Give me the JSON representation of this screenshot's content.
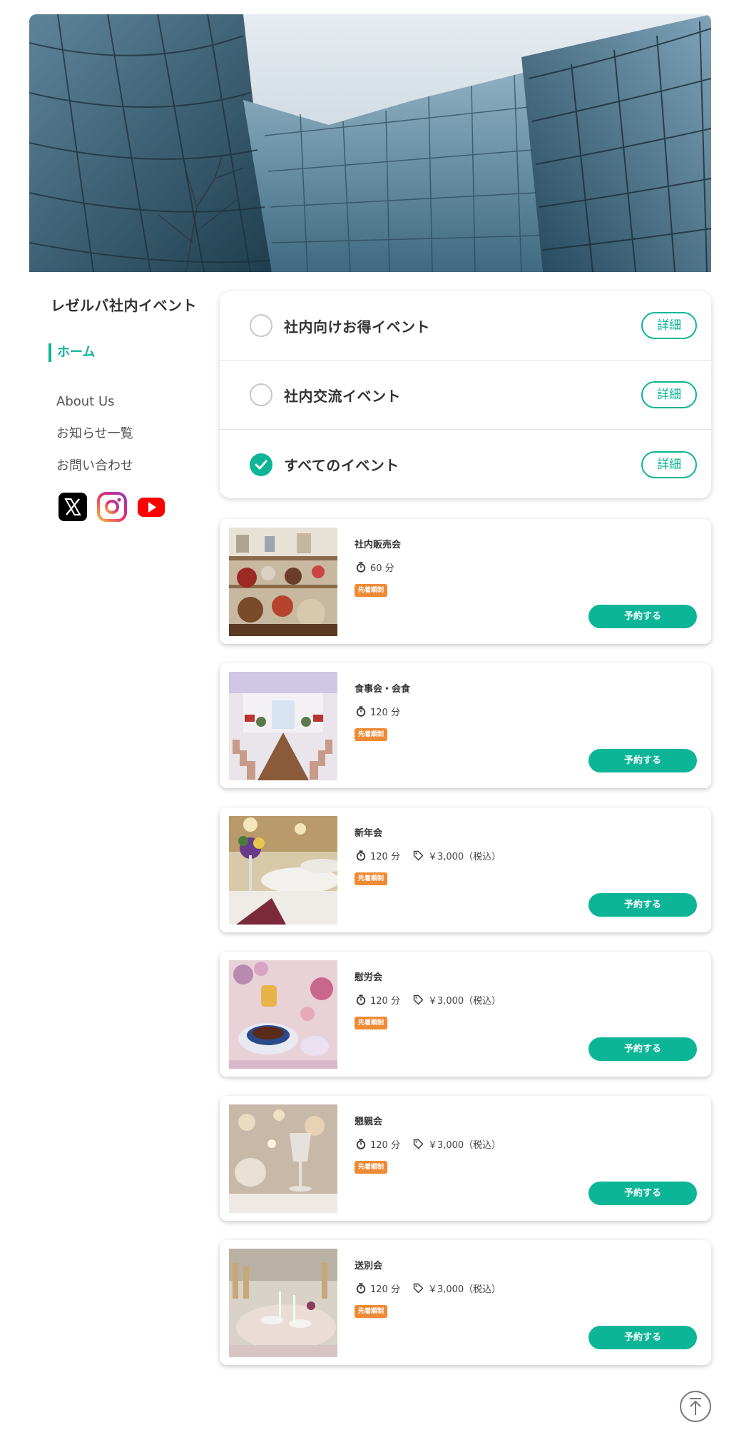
{
  "site": {
    "title": "レゼルバ社内イベント"
  },
  "nav": {
    "active": "ホーム",
    "items": [
      "About Us",
      "お知らせ一覧",
      "お問い合わせ"
    ]
  },
  "socials": [
    {
      "icon": "x-icon",
      "color": "#000000"
    },
    {
      "icon": "instagram-icon",
      "color": "#e1306c"
    },
    {
      "icon": "youtube-icon",
      "color": "#ff0000"
    }
  ],
  "filters": [
    {
      "label": "社内向けお得イベント",
      "checked": false,
      "detail": "詳細"
    },
    {
      "label": "社内交流イベント",
      "checked": false,
      "detail": "詳細"
    },
    {
      "label": "すべてのイベント",
      "checked": true,
      "detail": "詳細"
    }
  ],
  "events": [
    {
      "title": "社内販売会",
      "duration": "60 分",
      "price": "",
      "badge": "先着順制",
      "button": "予約する",
      "image": "market-photo"
    },
    {
      "title": "食事会・会食",
      "duration": "120 分",
      "price": "",
      "badge": "先着順制",
      "button": "予約する",
      "image": "banquet-hall-photo"
    },
    {
      "title": "新年会",
      "duration": "120 分",
      "price": "￥3,000（税込）",
      "badge": "先着順制",
      "button": "予約する",
      "image": "ballroom-photo"
    },
    {
      "title": "慰労会",
      "duration": "120 分",
      "price": "￥3,000（税込）",
      "badge": "先着順制",
      "button": "予約する",
      "image": "tea-table-photo"
    },
    {
      "title": "懇親会",
      "duration": "120 分",
      "price": "￥3,000（税込）",
      "badge": "先着順制",
      "button": "予約する",
      "image": "glasses-photo"
    },
    {
      "title": "送別会",
      "duration": "120 分",
      "price": "￥3,000（税込）",
      "badge": "先着順制",
      "button": "予約する",
      "image": "wedding-table-photo"
    }
  ],
  "colors": {
    "accent": "#0bb596",
    "badge": "#ef8a35"
  }
}
